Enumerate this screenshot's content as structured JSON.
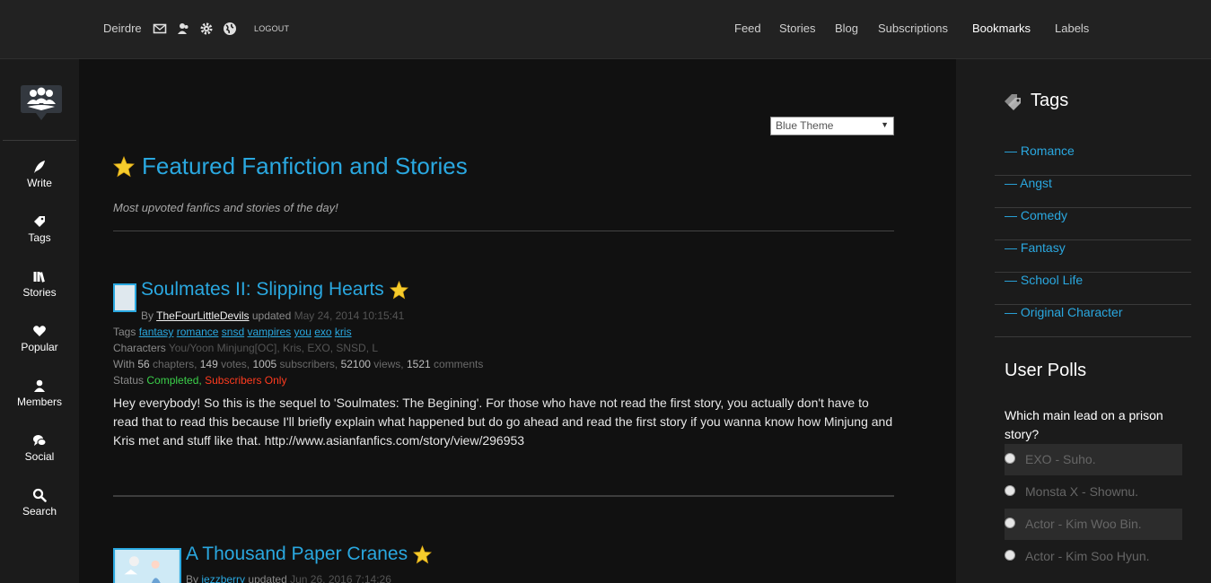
{
  "header": {
    "username": "Deirdre",
    "logout_label": "LOGOUT",
    "icons": [
      "mail-icon",
      "friends-icon",
      "gear-icon",
      "globe-icon"
    ],
    "nav": [
      "Feed",
      "Stories",
      "Blog",
      "Subscriptions",
      "Bookmarks",
      "Labels"
    ]
  },
  "sidebar": {
    "items": [
      {
        "label": "Write",
        "icon": "quill-icon"
      },
      {
        "label": "Tags",
        "icon": "tag-icon"
      },
      {
        "label": "Stories",
        "icon": "books-icon"
      },
      {
        "label": "Popular",
        "icon": "heart-icon"
      },
      {
        "label": "Members",
        "icon": "member-icon"
      },
      {
        "label": "Social",
        "icon": "chat-icon"
      },
      {
        "label": "Search",
        "icon": "search-icon"
      }
    ]
  },
  "main": {
    "theme_select": "Blue Theme",
    "title": "Featured Fanfiction and Stories",
    "subtitle": "Most upvoted fanfics and stories of the day!",
    "stories": [
      {
        "title": "Soulmates II: Slipping Hearts",
        "by_label": "By",
        "author": "TheFourLittleDevils",
        "updated_label": "updated",
        "updated": "May 24, 2014 10:15:41",
        "tags_label": "Tags",
        "tags": [
          "fantasy",
          "romance",
          "snsd",
          "vampires",
          "you",
          "exo",
          "kris"
        ],
        "characters_label": "Characters",
        "characters": "You/Yoon Minjung[OC], Kris, EXO, SNSD, L",
        "with_label": "With",
        "chapters": "56",
        "chapters_label": "chapters,",
        "votes": "149",
        "votes_label": "votes,",
        "subscribers": "1005",
        "subscribers_label": "subscribers,",
        "views": "52100",
        "views_label": "views,",
        "comments": "1521",
        "comments_label": "comments",
        "status_label": "Status",
        "status_completed": "Completed,",
        "status_subscribers": "Subscribers Only",
        "description": "Hey everybody! So this is the sequel to 'Soulmates: The Begining'. For those who have not read the first story, you actually don't have to read that to read this because I'll briefly explain what happened but do go ahead and read the first story if you wanna know how Minjung and Kris met and stuff like that. http://www.asianfanfics.com/story/view/296953"
      },
      {
        "title": "A Thousand Paper Cranes",
        "by_label": "By",
        "author": "jezzberry",
        "updated_label": "updated",
        "updated": "Jun 26, 2016 7:14:26"
      }
    ]
  },
  "rightbar": {
    "tags_title": "Tags",
    "tags": [
      "— Romance",
      "— Angst",
      "— Comedy",
      "— Fantasy",
      "— School Life",
      "— Original Character"
    ],
    "polls_title": "User Polls",
    "poll_question": "Which main lead on a prison story?",
    "poll_options": [
      "EXO - Suho.",
      "Monsta X - Shownu.",
      "Actor - Kim Woo Bin.",
      "Actor - Kim Soo Hyun."
    ]
  },
  "colors": {
    "accent": "#2aa8e0",
    "completed": "#3bd14a",
    "subscribers_only": "#ff3b1f",
    "background": "#111111",
    "panel": "#1b1b1b"
  }
}
